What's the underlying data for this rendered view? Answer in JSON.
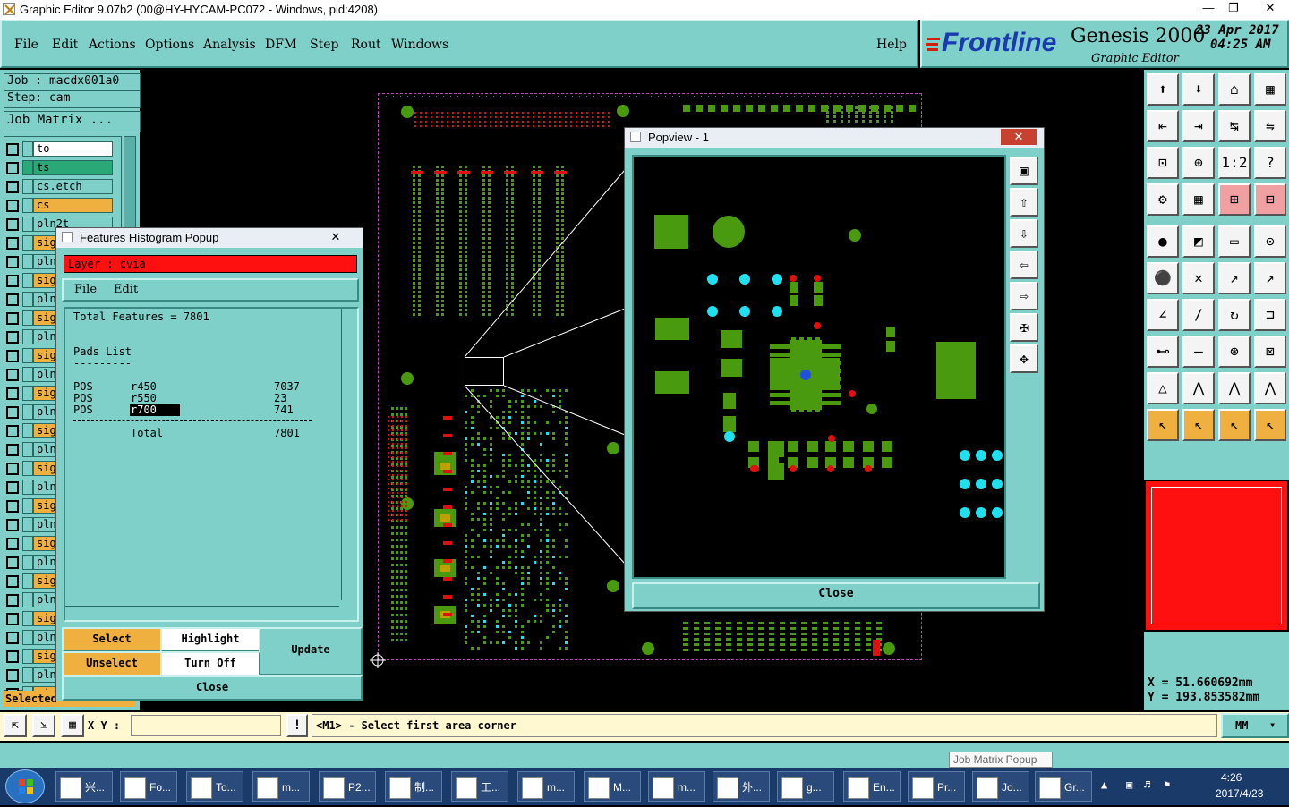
{
  "window": {
    "title": "Graphic Editor 9.07b2 (00@HY-HYCAM-PC072 - Windows, pid:4208)"
  },
  "menu": [
    "File",
    "Edit",
    "Actions",
    "Options",
    "Analysis",
    "DFM",
    "Step",
    "Rout",
    "Windows"
  ],
  "help_label": "Help",
  "brand": {
    "logo": "Frontline",
    "product": "Genesis 2000",
    "subtitle": "Graphic Editor",
    "date": "23 Apr 2017",
    "time": "04:25 AM"
  },
  "left": {
    "job": "Job : macdx001a0",
    "step": "Step: cam",
    "job_matrix": "Job Matrix ...",
    "layers": [
      {
        "name": "to",
        "color": "#ffffff"
      },
      {
        "name": "ts",
        "color": "#2aa878"
      },
      {
        "name": "cs.etch",
        "color": "#7fd0c8"
      },
      {
        "name": "cs",
        "color": "#f0b040"
      },
      {
        "name": "pln2t",
        "color": "#7fd0c8"
      },
      {
        "name": "sig",
        "color": "#f0b040"
      },
      {
        "name": "pln",
        "color": "#7fd0c8"
      },
      {
        "name": "sig",
        "color": "#f0b040"
      },
      {
        "name": "pln",
        "color": "#7fd0c8"
      },
      {
        "name": "sig",
        "color": "#f0b040"
      },
      {
        "name": "pln",
        "color": "#7fd0c8"
      },
      {
        "name": "sig",
        "color": "#f0b040"
      },
      {
        "name": "pln",
        "color": "#7fd0c8"
      },
      {
        "name": "sig",
        "color": "#f0b040"
      },
      {
        "name": "pln",
        "color": "#7fd0c8"
      },
      {
        "name": "sig",
        "color": "#f0b040"
      },
      {
        "name": "pln",
        "color": "#7fd0c8"
      },
      {
        "name": "sig",
        "color": "#f0b040"
      },
      {
        "name": "pln",
        "color": "#7fd0c8"
      },
      {
        "name": "sig",
        "color": "#f0b040"
      },
      {
        "name": "pln",
        "color": "#7fd0c8"
      },
      {
        "name": "sig",
        "color": "#f0b040"
      },
      {
        "name": "pln",
        "color": "#7fd0c8"
      },
      {
        "name": "sig",
        "color": "#f0b040"
      },
      {
        "name": "pln",
        "color": "#7fd0c8"
      },
      {
        "name": "sig",
        "color": "#f0b040"
      },
      {
        "name": "pln",
        "color": "#7fd0c8"
      },
      {
        "name": "sig",
        "color": "#f0b040"
      },
      {
        "name": "pln",
        "color": "#7fd0c8"
      },
      {
        "name": "sig",
        "color": "#f0b040"
      }
    ],
    "selected_label": "Selected"
  },
  "histogram": {
    "title": "Features Histogram Popup",
    "layer": "Layer :  cvia",
    "menu": [
      "File",
      "Edit"
    ],
    "total_line": "Total Features = 7801",
    "pads_heading": "Pads List",
    "underline": "---------",
    "rows": [
      {
        "pol": "POS",
        "sym": "r450",
        "count": "7037"
      },
      {
        "pol": "POS",
        "sym": "r550",
        "count": "23"
      },
      {
        "pol": "POS",
        "sym": "r700",
        "count": "741"
      }
    ],
    "total_label": "Total",
    "total_value": "7801",
    "buttons": {
      "select": "Select",
      "highlight": "Highlight",
      "update": "Update",
      "unselect": "Unselect",
      "turn_off": "Turn Off",
      "close": "Close"
    }
  },
  "popview": {
    "title": "Popview - 1",
    "close": "Close"
  },
  "coords": {
    "x": "X  = 51.660692mm",
    "y": "Y  = 193.853582mm"
  },
  "status": {
    "xy_label": "X Y :",
    "xy_value": "",
    "message": "<M1> - Select first area corner",
    "units": "MM"
  },
  "tooltip": "Job Matrix Popup",
  "taskbar": {
    "items": [
      "兴...",
      "Fo...",
      "To...",
      "m...",
      "P2...",
      "制...",
      "工...",
      "m...",
      "M...",
      "m...",
      "外...",
      "g...",
      "En...",
      "Pr...",
      "Jo...",
      "Gr..."
    ],
    "time": "4:26",
    "date": "2017/4/23"
  },
  "colors": {
    "panel": "#7fd0c8",
    "layer_highlight": "#ff1010",
    "pad_green": "#4a9a10",
    "via_cyan": "#20e0f0",
    "drill_red": "#e01010"
  }
}
